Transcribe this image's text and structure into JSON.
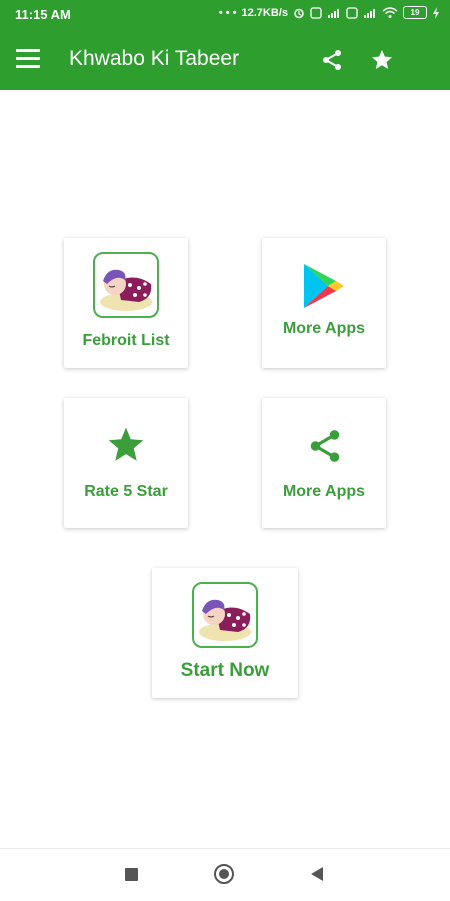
{
  "status_bar": {
    "time": "11:15 AM",
    "net_speed": "12.7KB/s",
    "battery": "19"
  },
  "app_bar": {
    "title": "Khwabo Ki Tabeer",
    "menu_icon": "hamburger-menu-icon",
    "share_icon": "share-icon",
    "star_icon": "star-icon"
  },
  "cards": {
    "favorite": {
      "label": "Febroit List",
      "icon": "sleeping-child-icon"
    },
    "more_apps_play": {
      "label": "More Apps",
      "icon": "play-store-icon"
    },
    "rate": {
      "label": "Rate 5 Star",
      "icon": "star-icon"
    },
    "more_apps_share": {
      "label": "More Apps",
      "icon": "share-icon"
    },
    "start": {
      "label": "Start Now",
      "icon": "sleeping-child-icon"
    }
  },
  "colors": {
    "primary": "#2e9e2f",
    "accent_text": "#3a9f3b"
  }
}
